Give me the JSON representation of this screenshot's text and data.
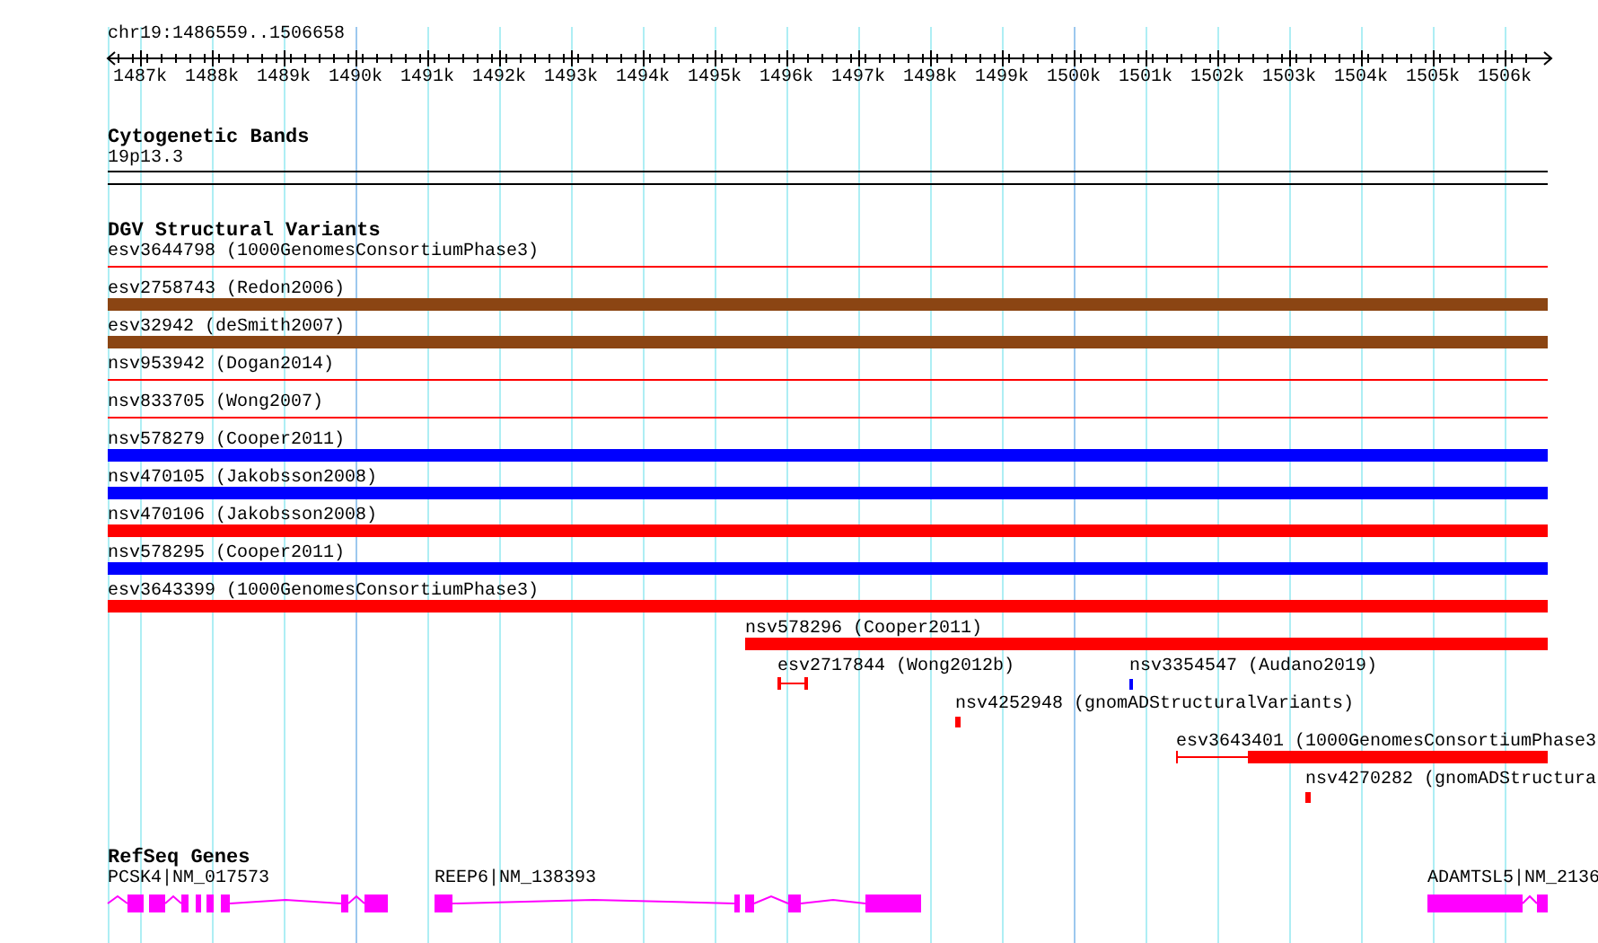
{
  "ruler": {
    "region": "chr19:1486559..1506658",
    "ticks": [
      "1487k",
      "1488k",
      "1489k",
      "1490k",
      "1491k",
      "1492k",
      "1493k",
      "1494k",
      "1495k",
      "1496k",
      "1497k",
      "1498k",
      "1499k",
      "1500k",
      "1501k",
      "1502k",
      "1503k",
      "1504k",
      "1505k",
      "1506k"
    ]
  },
  "cytogenetic_bands": {
    "title": "Cytogenetic Bands",
    "bands": [
      {
        "label": "19p13.3"
      }
    ]
  },
  "dgv_structural_variants": {
    "title": "DGV Structural Variants",
    "lanes": [
      [
        {
          "label": "esv3644798 (1000GenomesConsortiumPhase3)",
          "kind": "line",
          "color": "#ff0000"
        }
      ],
      [
        {
          "label": "esv2758743 (Redon2006)",
          "kind": "bar",
          "color": "#8b4513"
        }
      ],
      [
        {
          "label": "esv32942 (deSmith2007)",
          "kind": "bar",
          "color": "#8b4513"
        }
      ],
      [
        {
          "label": "nsv953942 (Dogan2014)",
          "kind": "line",
          "color": "#ff0000"
        }
      ],
      [
        {
          "label": "nsv833705 (Wong2007)",
          "kind": "line",
          "color": "#ff0000"
        }
      ],
      [
        {
          "label": "nsv578279 (Cooper2011)",
          "kind": "bar",
          "color": "#0000ff"
        }
      ],
      [
        {
          "label": "nsv470105 (Jakobsson2008)",
          "kind": "bar",
          "color": "#0000ff"
        }
      ],
      [
        {
          "label": "nsv470106 (Jakobsson2008)",
          "kind": "bar",
          "color": "#ff0000"
        }
      ],
      [
        {
          "label": "nsv578295 (Cooper2011)",
          "kind": "bar",
          "color": "#0000ff"
        }
      ],
      [
        {
          "label": "esv3643399 (1000GenomesConsortiumPhase3)",
          "kind": "bar",
          "color": "#ff0000"
        }
      ],
      [
        {
          "label": "nsv578296 (Cooper2011)",
          "kind": "bar",
          "color": "#ff0000"
        }
      ],
      [
        {
          "label": "esv2717844 (Wong2012b)",
          "kind": "whisker",
          "color": "#ff0000"
        },
        {
          "label": "nsv3354547 (Audano2019)",
          "kind": "mark",
          "color": "#0000ff"
        }
      ],
      [
        {
          "label": "nsv4252948 (gnomADStructuralVariants)",
          "kind": "mark",
          "color": "#ff0000"
        }
      ],
      [
        {
          "label": "esv3643401 (1000GenomesConsortiumPhase3",
          "kind": "partial",
          "color": "#ff0000"
        }
      ],
      [
        {
          "label": "nsv4270282 (gnomADStructura",
          "kind": "mark",
          "color": "#ff0000"
        }
      ]
    ]
  },
  "refseq_genes": {
    "title": "RefSeq Genes",
    "genes": [
      {
        "label": "PCSK4|NM_017573"
      },
      {
        "label": "REEP6|NM_138393"
      },
      {
        "label": "ADAMTSL5|NM_2136"
      }
    ]
  }
}
